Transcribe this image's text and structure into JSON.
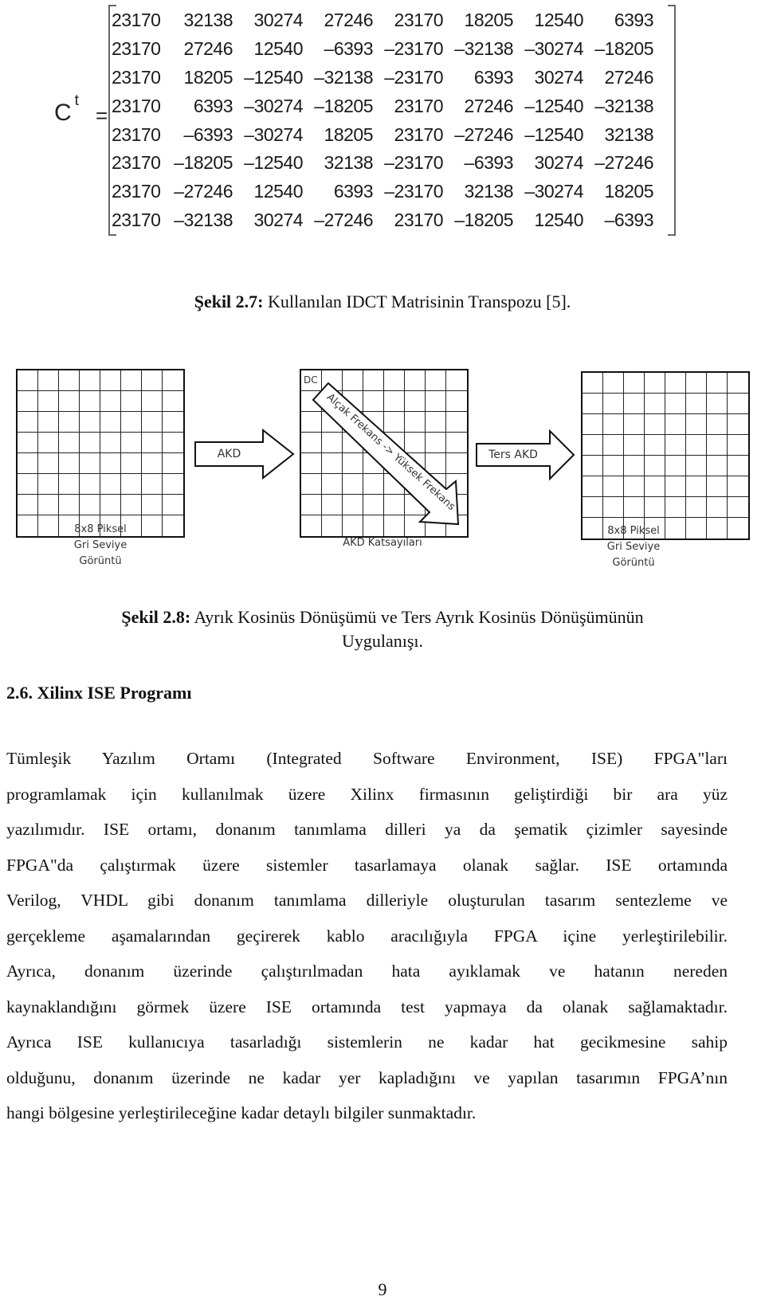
{
  "matrix_figure": {
    "symbol": "C",
    "superscript": "t",
    "equals": "=",
    "rows": [
      [
        "23170",
        "32138",
        "30274",
        "27246",
        "23170",
        "18205",
        "12540",
        "6393"
      ],
      [
        "23170",
        "27246",
        "12540",
        "–6393",
        "–23170",
        "–32138",
        "–30274",
        "–18205"
      ],
      [
        "23170",
        "18205",
        "–12540",
        "–32138",
        "–23170",
        "6393",
        "30274",
        "27246"
      ],
      [
        "23170",
        "6393",
        "–30274",
        "–18205",
        "23170",
        "27246",
        "–12540",
        "–32138"
      ],
      [
        "23170",
        "–6393",
        "–30274",
        "18205",
        "23170",
        "–27246",
        "–12540",
        "32138"
      ],
      [
        "23170",
        "–18205",
        "–12540",
        "32138",
        "–23170",
        "–6393",
        "30274",
        "–27246"
      ],
      [
        "23170",
        "–27246",
        "12540",
        "6393",
        "–23170",
        "32138",
        "–30274",
        "18205"
      ],
      [
        "23170",
        "–32138",
        "30274",
        "–27246",
        "23170",
        "–18205",
        "12540",
        "–6393"
      ]
    ],
    "caption_label": "Şekil 2.7:",
    "caption_text": " Kullanılan IDCT Matrisinin Transpozu [5]."
  },
  "dct_diagram": {
    "left_grid_label": [
      "8x8 Piksel",
      "Gri Seviye",
      "Görüntü"
    ],
    "forward_arrow_label": "AKD",
    "middle_grid_corner": "DC",
    "diagonal_arrow_label": "Alçak Frekans -> Yüksek Frekans",
    "middle_grid_label": "AKD Katsayıları",
    "inverse_arrow_label": "Ters AKD",
    "right_grid_label": [
      "8x8 Piksel",
      "Gri Seviye",
      "Görüntü"
    ],
    "caption_label": "Şekil 2.8:",
    "caption_line1": " Ayrık Kosinüs Dönüşümü ve Ters Ayrık Kosinüs Dönüşümünün",
    "caption_line2": "Uygulanışı."
  },
  "section": {
    "heading": "2.6. Xilinx ISE Programı",
    "lines": [
      "Tümleşik  Yazılım  Ortamı    (Integrated  Software  Environment,    ISE)    FPGA\"ları",
      "programlamak  için  kullanılmak  üzere  Xilinx  firmasının  geliştirdiği  bir  ara  yüz",
      "yazılımıdır. ISE ortamı, donanım tanımlama dilleri ya da şematik çizimler sayesinde",
      "FPGA\"da  çalıştırmak  üzere  sistemler  tasarlamaya  olanak  sağlar.  ISE  ortamında",
      "Verilog, VHDL gibi donanım tanımlama dilleriyle oluşturulan tasarım sentezleme ve",
      "gerçekleme aşamalarından geçirerek kablo aracılığıyla FPGA içine yerleştirilebilir.",
      "Ayrıca,  donanım  üzerinde  çalıştırılmadan  hata  ayıklamak  ve  hatanın  nereden",
      "kaynaklandığını görmek üzere ISE ortamında test yapmaya da olanak sağlamaktadır.",
      "Ayrıca  ISE  kullanıcıya  tasarladığı  sistemlerin  ne  kadar  hat  gecikmesine  sahip",
      "olduğunu, donanım üzerinde ne kadar yer kapladığını ve yapılan tasarımın FPGA’nın",
      "hangi bölgesine yerleştirileceğine kadar detaylı bilgiler sunmaktadır."
    ]
  },
  "page_number": "9"
}
